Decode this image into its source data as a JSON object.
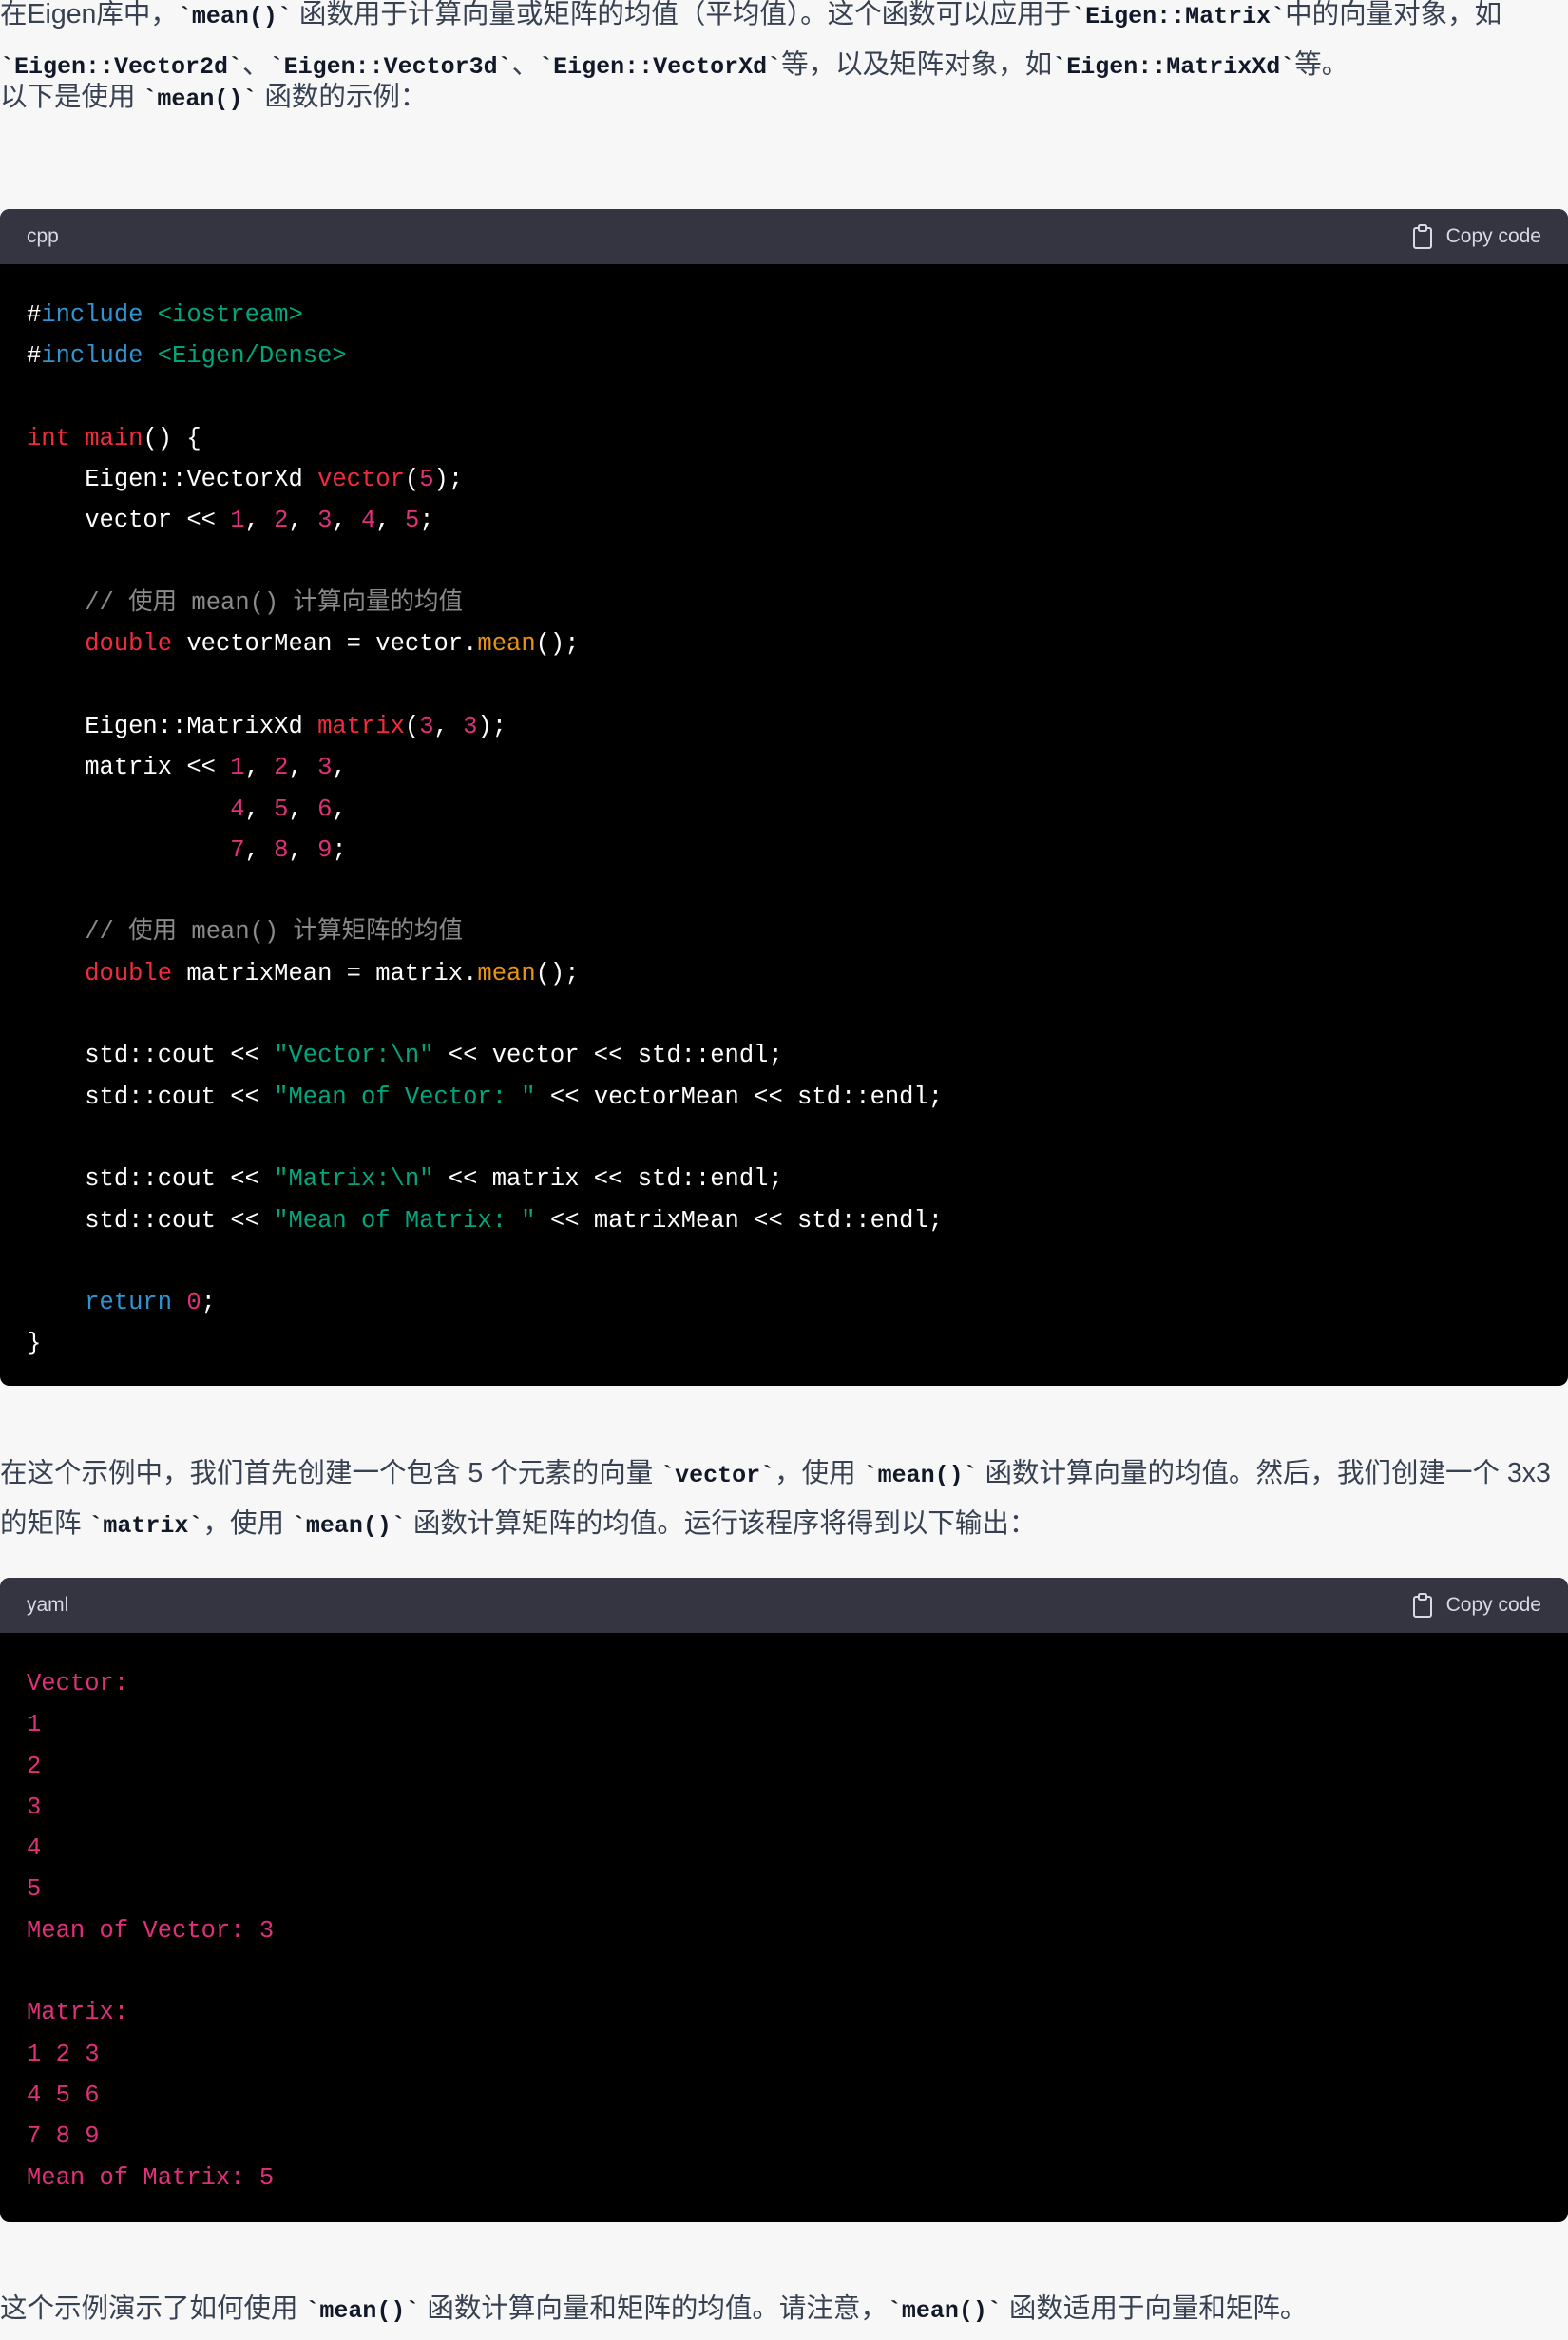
{
  "paragraphs": {
    "intro": [
      {
        "t": "text",
        "v": "在Eigen库中，"
      },
      {
        "t": "code",
        "v": "`mean()`"
      },
      {
        "t": "text",
        "v": " 函数用于计算向量或矩阵的均值（平均值）。这个函数可以应用于"
      },
      {
        "t": "code",
        "v": "`Eigen::Matrix`"
      },
      {
        "t": "text",
        "v": "中的向量对象，如"
      },
      {
        "t": "code",
        "v": "`Eigen::Vector2d`"
      },
      {
        "t": "text",
        "v": "、"
      },
      {
        "t": "code",
        "v": "`Eigen::Vector3d`"
      },
      {
        "t": "text",
        "v": "、"
      },
      {
        "t": "code",
        "v": "`Eigen::VectorXd`"
      },
      {
        "t": "text",
        "v": "等，以及矩阵对象，如"
      },
      {
        "t": "code",
        "v": "`Eigen::MatrixXd`"
      },
      {
        "t": "text",
        "v": "等。"
      }
    ],
    "example_lead": [
      {
        "t": "text",
        "v": "以下是使用 "
      },
      {
        "t": "code",
        "v": "`mean()`"
      },
      {
        "t": "text",
        "v": " 函数的示例："
      }
    ],
    "explanation": [
      {
        "t": "text",
        "v": "在这个示例中，我们首先创建一个包含 5 个元素的向量 "
      },
      {
        "t": "code",
        "v": "`vector`"
      },
      {
        "t": "text",
        "v": "，使用 "
      },
      {
        "t": "code",
        "v": "`mean()`"
      },
      {
        "t": "text",
        "v": " 函数计算向量的均值。然后，我们创建一个 3x3 的矩阵 "
      },
      {
        "t": "code",
        "v": "`matrix`"
      },
      {
        "t": "text",
        "v": "，使用 "
      },
      {
        "t": "code",
        "v": "`mean()`"
      },
      {
        "t": "text",
        "v": " 函数计算矩阵的均值。运行该程序将得到以下输出："
      }
    ],
    "conclusion": [
      {
        "t": "text",
        "v": "这个示例演示了如何使用 "
      },
      {
        "t": "code",
        "v": "`mean()`"
      },
      {
        "t": "text",
        "v": " 函数计算向量和矩阵的均值。请注意，"
      },
      {
        "t": "code",
        "v": "`mean()`"
      },
      {
        "t": "text",
        "v": " 函数适用于向量和矩阵。"
      }
    ]
  },
  "code_blocks": [
    {
      "language": "cpp",
      "copy_label": "Copy code",
      "copy_icon": "clipboard-icon",
      "lines": [
        [
          [
            "plain",
            "#"
          ],
          [
            "dir",
            "include"
          ],
          [
            "plain",
            " "
          ],
          [
            "str",
            "<iostream>"
          ]
        ],
        [
          [
            "plain",
            "#"
          ],
          [
            "dir",
            "include"
          ],
          [
            "plain",
            " "
          ],
          [
            "str",
            "<Eigen/Dense>"
          ]
        ],
        [],
        [
          [
            "kw",
            "int"
          ],
          [
            "plain",
            " "
          ],
          [
            "fn",
            "main"
          ],
          [
            "plain",
            "() {"
          ]
        ],
        [
          [
            "plain",
            "    Eigen::VectorXd "
          ],
          [
            "fn",
            "vector"
          ],
          [
            "plain",
            "("
          ],
          [
            "num",
            "5"
          ],
          [
            "plain",
            ");"
          ]
        ],
        [
          [
            "plain",
            "    vector << "
          ],
          [
            "num",
            "1"
          ],
          [
            "plain",
            ", "
          ],
          [
            "num",
            "2"
          ],
          [
            "plain",
            ", "
          ],
          [
            "num",
            "3"
          ],
          [
            "plain",
            ", "
          ],
          [
            "num",
            "4"
          ],
          [
            "plain",
            ", "
          ],
          [
            "num",
            "5"
          ],
          [
            "plain",
            ";"
          ]
        ],
        [],
        [
          [
            "com",
            "    // 使用 mean() 计算向量的均值"
          ]
        ],
        [
          [
            "plain",
            "    "
          ],
          [
            "kw",
            "double"
          ],
          [
            "plain",
            " vectorMean = vector."
          ],
          [
            "meth",
            "mean"
          ],
          [
            "plain",
            "();"
          ]
        ],
        [],
        [
          [
            "plain",
            "    Eigen::MatrixXd "
          ],
          [
            "fn",
            "matrix"
          ],
          [
            "plain",
            "("
          ],
          [
            "num",
            "3"
          ],
          [
            "plain",
            ", "
          ],
          [
            "num",
            "3"
          ],
          [
            "plain",
            ");"
          ]
        ],
        [
          [
            "plain",
            "    matrix << "
          ],
          [
            "num",
            "1"
          ],
          [
            "plain",
            ", "
          ],
          [
            "num",
            "2"
          ],
          [
            "plain",
            ", "
          ],
          [
            "num",
            "3"
          ],
          [
            "plain",
            ","
          ]
        ],
        [
          [
            "plain",
            "              "
          ],
          [
            "num",
            "4"
          ],
          [
            "plain",
            ", "
          ],
          [
            "num",
            "5"
          ],
          [
            "plain",
            ", "
          ],
          [
            "num",
            "6"
          ],
          [
            "plain",
            ","
          ]
        ],
        [
          [
            "plain",
            "              "
          ],
          [
            "num",
            "7"
          ],
          [
            "plain",
            ", "
          ],
          [
            "num",
            "8"
          ],
          [
            "plain",
            ", "
          ],
          [
            "num",
            "9"
          ],
          [
            "plain",
            ";"
          ]
        ],
        [],
        [
          [
            "com",
            "    // 使用 mean() 计算矩阵的均值"
          ]
        ],
        [
          [
            "plain",
            "    "
          ],
          [
            "kw",
            "double"
          ],
          [
            "plain",
            " matrixMean = matrix."
          ],
          [
            "meth",
            "mean"
          ],
          [
            "plain",
            "();"
          ]
        ],
        [],
        [
          [
            "plain",
            "    std::cout << "
          ],
          [
            "str",
            "\"Vector:\\n\""
          ],
          [
            "plain",
            " << vector << std::endl;"
          ]
        ],
        [
          [
            "plain",
            "    std::cout << "
          ],
          [
            "str",
            "\"Mean of Vector: \""
          ],
          [
            "plain",
            " << vectorMean << std::endl;"
          ]
        ],
        [],
        [
          [
            "plain",
            "    std::cout << "
          ],
          [
            "str",
            "\"Matrix:\\n\""
          ],
          [
            "plain",
            " << matrix << std::endl;"
          ]
        ],
        [
          [
            "plain",
            "    std::cout << "
          ],
          [
            "str",
            "\"Mean of Matrix: \""
          ],
          [
            "plain",
            " << matrixMean << std::endl;"
          ]
        ],
        [],
        [
          [
            "plain",
            "    "
          ],
          [
            "kw2",
            "return"
          ],
          [
            "plain",
            " "
          ],
          [
            "num",
            "0"
          ],
          [
            "plain",
            ";"
          ]
        ],
        [
          [
            "plain",
            "}"
          ]
        ]
      ]
    },
    {
      "language": "yaml",
      "copy_label": "Copy code",
      "copy_icon": "clipboard-icon",
      "lines": [
        [
          [
            "out",
            "Vector:"
          ]
        ],
        [
          [
            "out",
            "1"
          ]
        ],
        [
          [
            "out",
            "2"
          ]
        ],
        [
          [
            "out",
            "3"
          ]
        ],
        [
          [
            "out",
            "4"
          ]
        ],
        [
          [
            "out",
            "5"
          ]
        ],
        [
          [
            "out",
            "Mean of Vector: 3"
          ]
        ],
        [],
        [
          [
            "out",
            "Matrix:"
          ]
        ],
        [
          [
            "out",
            "1 2 3"
          ]
        ],
        [
          [
            "out",
            "4 5 6"
          ]
        ],
        [
          [
            "out",
            "7 8 9"
          ]
        ],
        [
          [
            "out",
            "Mean of Matrix: 5"
          ]
        ]
      ]
    }
  ],
  "colors": {
    "page_bg": "#f7f7f8",
    "code_bg": "#000000",
    "code_header_bg": "#343541",
    "directive": "#2e95d3",
    "string": "#00a67d",
    "keyword": "#f22c3d",
    "number": "#df3079",
    "method": "#e9950c",
    "comment": "#8a8a8a"
  }
}
